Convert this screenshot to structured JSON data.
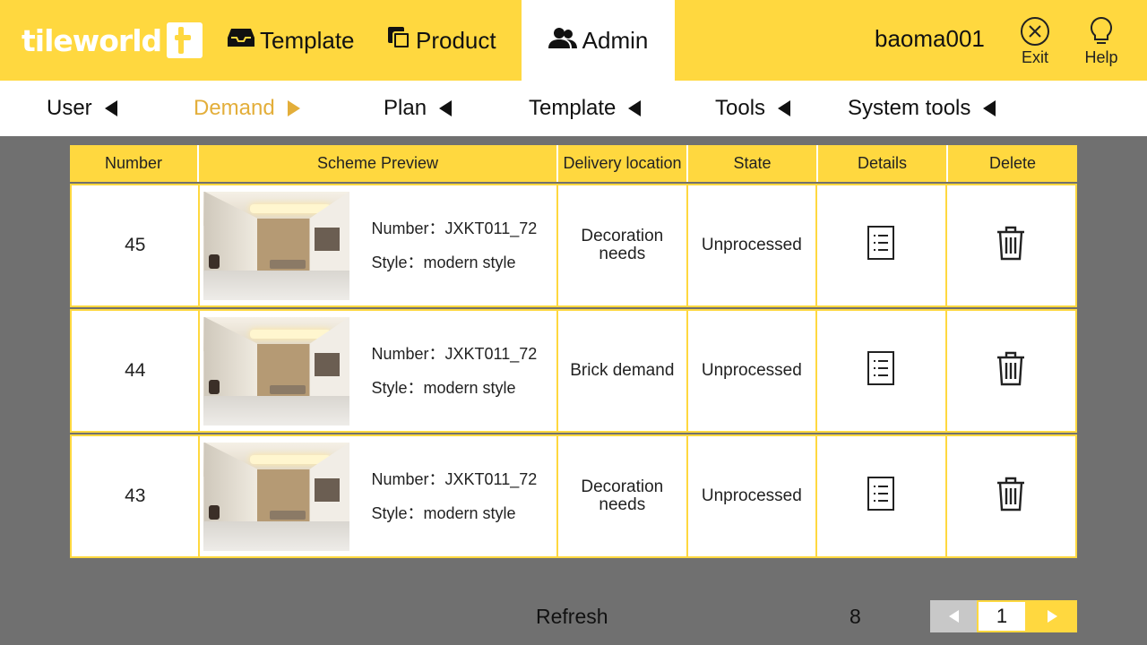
{
  "brand": {
    "name": "tileworld",
    "accent": "#FFD83F",
    "active_sub": "#E3AE3A"
  },
  "topnav": {
    "template": "Template",
    "product": "Product",
    "admin": "Admin"
  },
  "user": {
    "name": "baoma001",
    "exit": "Exit",
    "help": "Help"
  },
  "subnav": {
    "items": [
      {
        "label": "User"
      },
      {
        "label": "Demand",
        "active": true
      },
      {
        "label": "Plan"
      },
      {
        "label": "Template"
      },
      {
        "label": "Tools"
      },
      {
        "label": "System tools"
      }
    ]
  },
  "table": {
    "headers": [
      "Number",
      "Scheme Preview",
      "Delivery location",
      "State",
      "Details",
      "Delete"
    ],
    "rows": [
      {
        "number": "45",
        "scheme_number": "Number：JXKT011_72",
        "style": "Style：modern style",
        "location": "Decoration needs",
        "state": "Unprocessed"
      },
      {
        "number": "44",
        "scheme_number": "Number：JXKT011_72",
        "style": "Style：modern style",
        "location": "Brick demand",
        "state": "Unprocessed"
      },
      {
        "number": "43",
        "scheme_number": "Number：JXKT011_72",
        "style": "Style：modern style",
        "location": "Decoration needs",
        "state": "Unprocessed"
      }
    ]
  },
  "footer": {
    "refresh": "Refresh",
    "total": "8",
    "page": "1"
  }
}
